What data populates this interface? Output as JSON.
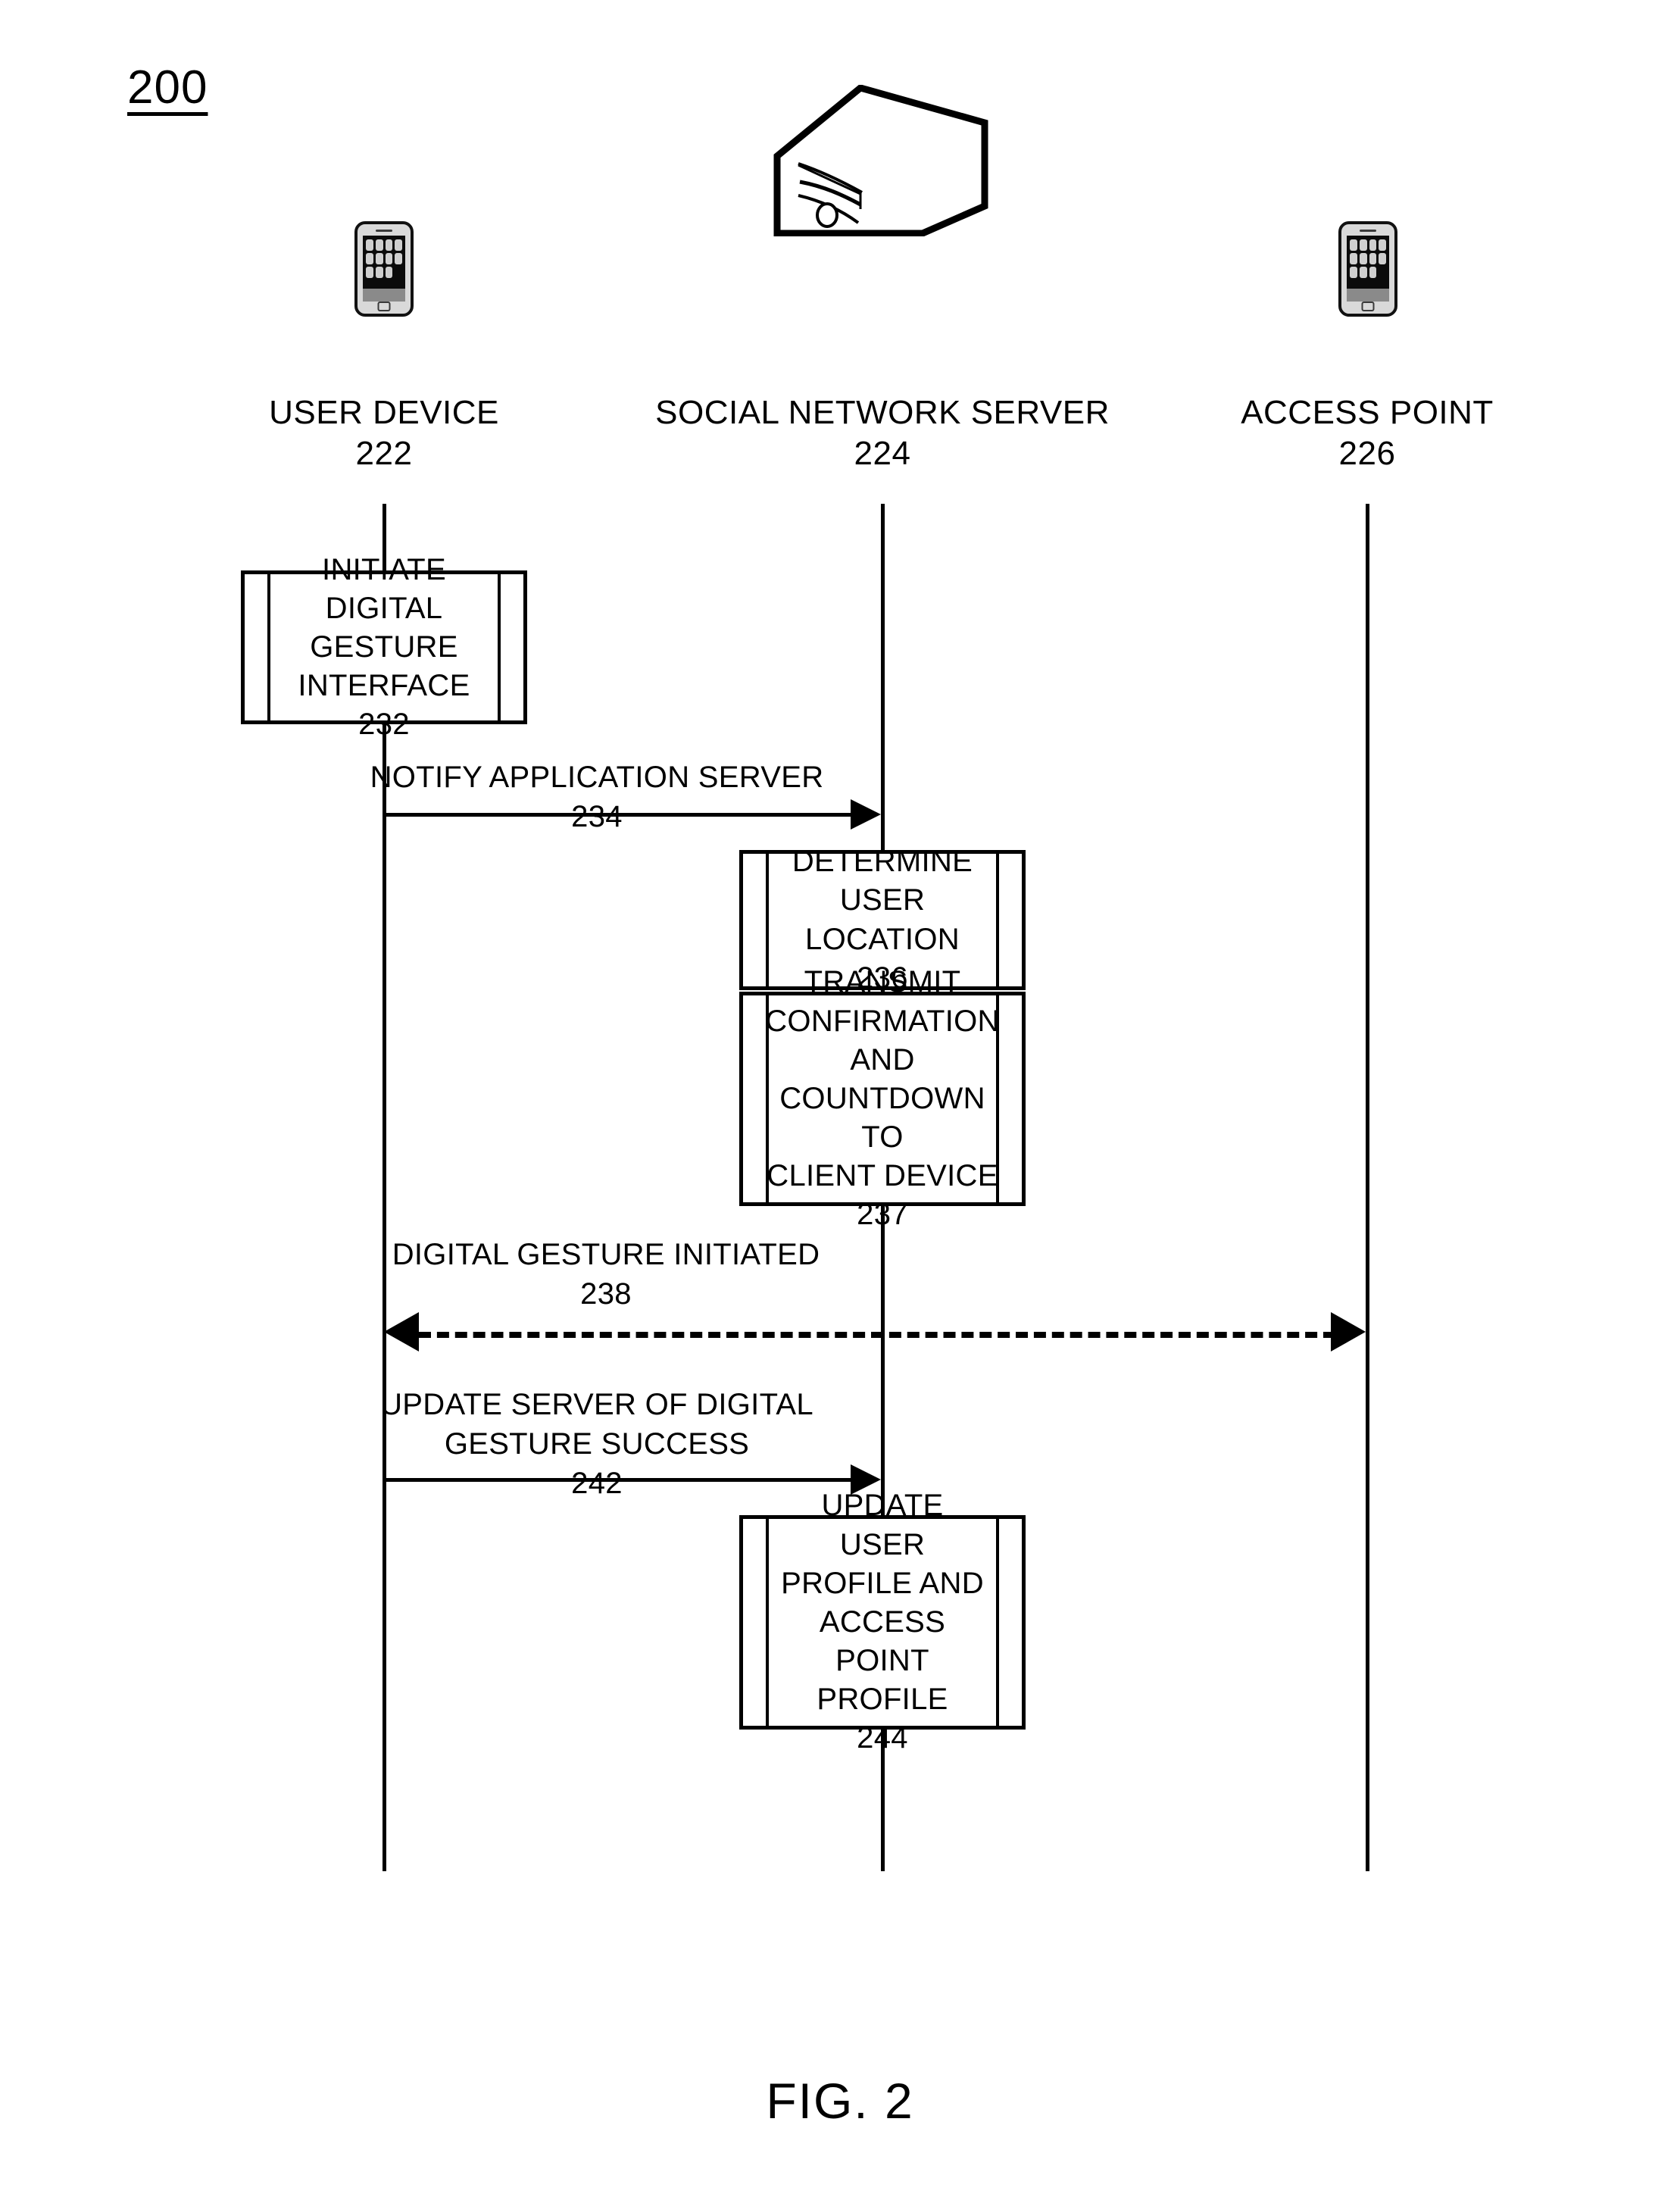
{
  "figure": {
    "number": "200",
    "caption": "FIG. 2"
  },
  "actors": [
    {
      "name": "USER DEVICE",
      "ref": "222",
      "icon": "smartphone-icon"
    },
    {
      "name": "SOCIAL NETWORK SERVER",
      "ref": "224",
      "icon": "server-tower-icon"
    },
    {
      "name": "ACCESS POINT",
      "ref": "226",
      "icon": "smartphone-icon"
    }
  ],
  "process_boxes": [
    {
      "id": "box-232",
      "text": "INITIATE DIGITAL\nGESTURE\nINTERFACE",
      "ref": "232",
      "actor": "USER DEVICE"
    },
    {
      "id": "box-236",
      "text": "DETERMINE\nUSER LOCATION",
      "ref": "236",
      "actor": "SOCIAL NETWORK SERVER"
    },
    {
      "id": "box-237",
      "text": "TRANSMIT\nCONFIRMATION\nAND\nCOUNTDOWN TO\nCLIENT DEVICE",
      "ref": "237",
      "actor": "SOCIAL NETWORK SERVER"
    },
    {
      "id": "box-244",
      "text": "UPDATE USER\nPROFILE AND\nACCESS POINT\nPROFILE",
      "ref": "244",
      "actor": "SOCIAL NETWORK SERVER"
    }
  ],
  "messages": [
    {
      "id": "msg-234",
      "text": "NOTIFY APPLICATION SERVER",
      "ref": "234",
      "from": "USER DEVICE",
      "to": "SOCIAL NETWORK SERVER",
      "style": "solid",
      "direction": "right"
    },
    {
      "id": "msg-238",
      "text": "DIGITAL GESTURE INITIATED",
      "ref": "238",
      "from": "USER DEVICE",
      "to": "ACCESS POINT",
      "style": "dashed",
      "direction": "both"
    },
    {
      "id": "msg-242",
      "text": "UPDATE SERVER OF DIGITAL\nGESTURE SUCCESS",
      "ref": "242",
      "from": "USER DEVICE",
      "to": "SOCIAL NETWORK SERVER",
      "style": "solid",
      "direction": "right"
    }
  ],
  "colors": {
    "ink": "#000000",
    "paper": "#ffffff"
  }
}
